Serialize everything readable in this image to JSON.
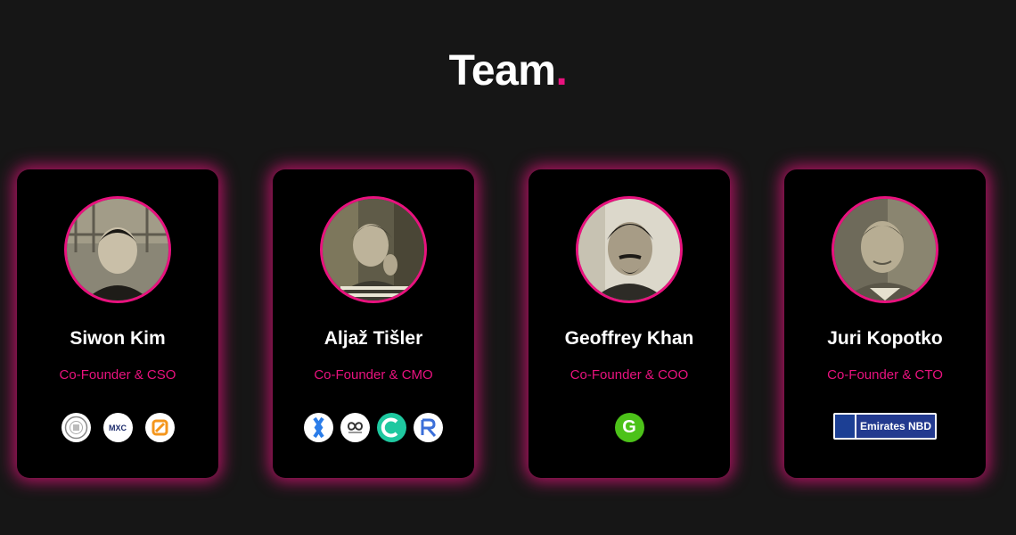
{
  "section": {
    "title": "Team",
    "title_dot": ".",
    "accent_color": "#e8127e"
  },
  "members": [
    {
      "name": "Siwon Kim",
      "role": "Co-Founder & CSO",
      "logos": [
        "university-seal-icon",
        "mxc-logo-icon",
        "orange-swap-logo-icon"
      ],
      "logo_texts": [
        "MXC"
      ]
    },
    {
      "name": "Aljaž Tišler",
      "role": "Co-Founder & CMO",
      "logos": [
        "blue-hexagon-logo-icon",
        "infinity-group-logo-icon",
        "green-ring-logo-icon",
        "rx-logo-icon"
      ]
    },
    {
      "name": "Geoffrey Khan",
      "role": "Co-Founder & COO",
      "logos": [
        "green-g-logo-icon"
      ],
      "logo_texts": [
        "G"
      ]
    },
    {
      "name": "Juri Kopotko",
      "role": "Co-Founder & CTO",
      "logos": [
        "emirates-nbd-logo"
      ],
      "logo_texts": [
        "Emirates NBD"
      ]
    }
  ]
}
